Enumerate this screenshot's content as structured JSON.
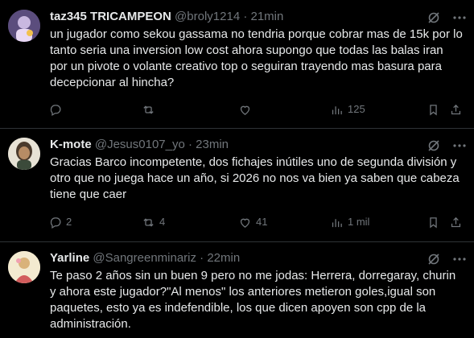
{
  "tweets": [
    {
      "name": "taz345 TRICAMPEON",
      "handle": "@broly1214",
      "sep": "·",
      "time": "21min",
      "text": "un jugador como sekou gassama no tendria porque cobrar mas de 15k por lo tanto seria una inversion low cost ahora supongo que todas las balas iran por un pivote o volante creativo top o seguiran trayendo mas basura para decepcionar al hincha?",
      "replies": "",
      "retweets": "",
      "likes": "",
      "views": "125"
    },
    {
      "name": "K-mote",
      "handle": "@Jesus0107_yo",
      "sep": "·",
      "time": "23min",
      "text": "Gracias Barco incompetente, dos fichajes inútiles uno de segunda división y otro que no juega hace un año, si 2026 no nos va bien ya saben que cabeza tiene que caer",
      "replies": "2",
      "retweets": "4",
      "likes": "41",
      "views": "1 mil"
    },
    {
      "name": "Yarline",
      "handle": "@Sangreenminariz",
      "sep": "·",
      "time": "22min",
      "text": "Te paso 2 años sin un buen 9 pero no me jodas: Herrera, dorregaray, churin y ahora este jugador?\"Al menos\" los anteriores metieron goles,igual son paquetes, esto ya es indefendible, los que dicen apoyen son cpp de la administración."
    }
  ],
  "icons": {
    "reply": "reply-icon",
    "retweet": "retweet-icon",
    "like": "like-icon",
    "views": "views-icon",
    "bookmark": "bookmark-icon",
    "share": "share-icon",
    "grok": "grok-icon",
    "more": "more-icon"
  },
  "colors": {
    "background": "#000000",
    "text": "#e7e9ea",
    "muted": "#71767b",
    "divider": "#2f3336"
  }
}
